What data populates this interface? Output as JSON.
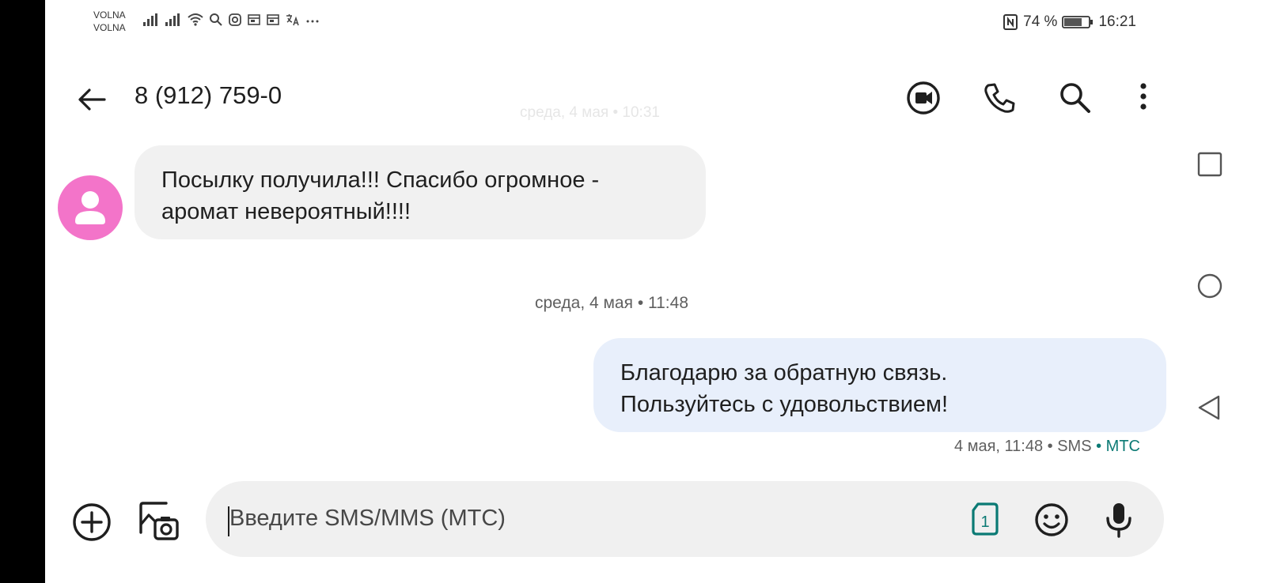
{
  "status_bar": {
    "carrier_1": "VOLNA",
    "carrier_2": "VOLNA",
    "battery_percent": "74 %",
    "time": "16:21",
    "icons": [
      "signal-icon",
      "wifi-icon",
      "search-icon",
      "instagram-icon",
      "notification-icon",
      "notification-icon",
      "translate-icon",
      "more-icon",
      "nfc-icon",
      "battery-icon"
    ]
  },
  "header": {
    "title": "8 (912) 759-0",
    "icons": [
      "back-arrow-icon",
      "video-call-icon",
      "phone-icon",
      "search-icon",
      "more-vert-icon"
    ]
  },
  "conversation": {
    "ghost_timestamp": "среда, 4 мая • 10:31",
    "incoming": {
      "line1": "Посылку получила!!! Спасибо огромное -",
      "line2": "аромат невероятный!!!!"
    },
    "date_separator": "среда, 4 мая • 11:48",
    "outgoing": {
      "line1": "Благодарю за обратную связь.",
      "line2": "Пользуйтесь с удовольствием!"
    },
    "outgoing_meta": "4 мая, 11:48 • SMS",
    "outgoing_meta_sep": " • ",
    "outgoing_carrier": "МТС"
  },
  "composer": {
    "placeholder": "Введите SMS/MMS (МТС)",
    "sim_label": "1"
  },
  "colors": {
    "avatar": "#f374c9",
    "incoming_bubble": "#f1f1f1",
    "outgoing_bubble": "#e8effb",
    "accent": "#0b7a74"
  }
}
